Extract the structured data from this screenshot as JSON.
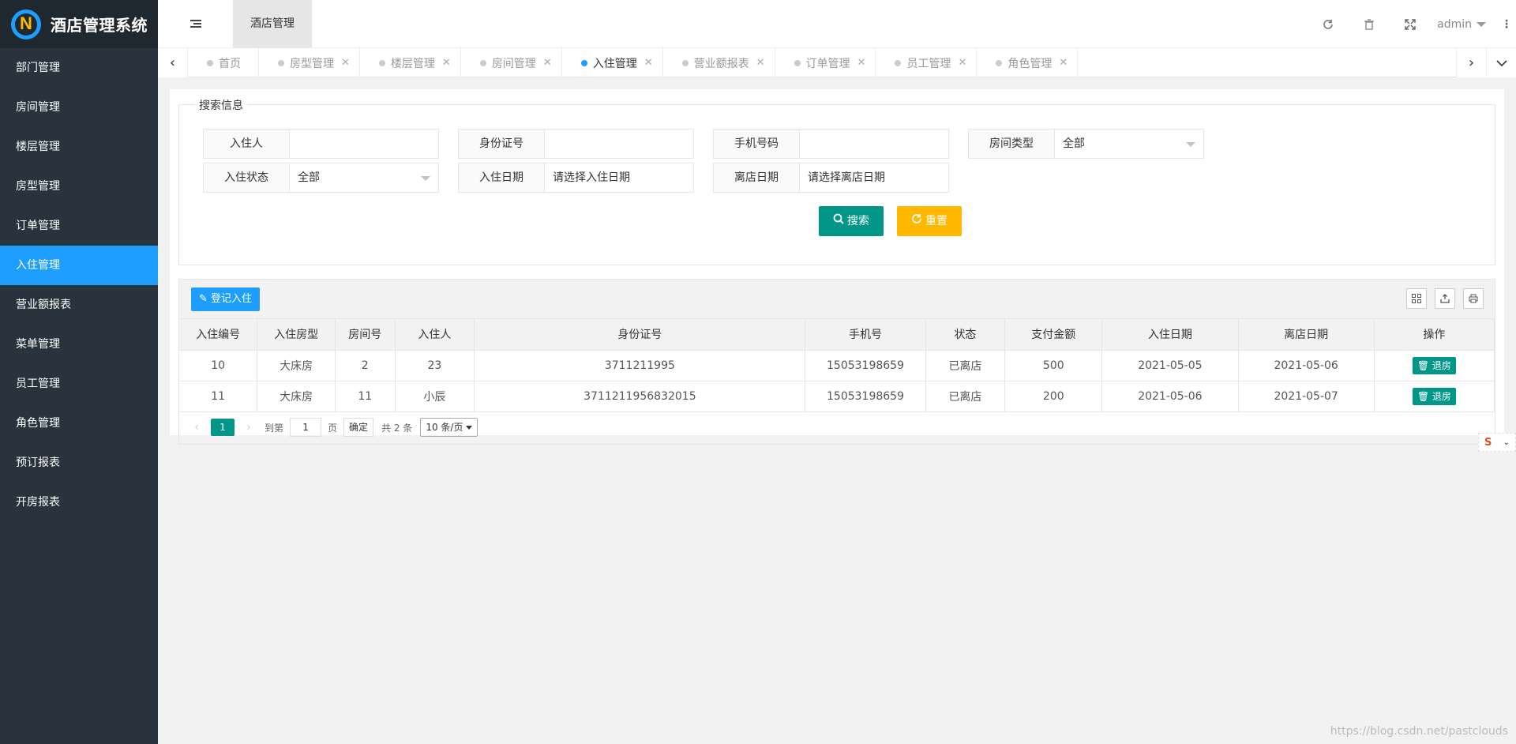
{
  "app": {
    "title": "酒店管理系统"
  },
  "sidebar": {
    "items": [
      {
        "label": "部门管理"
      },
      {
        "label": "房间管理"
      },
      {
        "label": "楼层管理"
      },
      {
        "label": "房型管理"
      },
      {
        "label": "订单管理"
      },
      {
        "label": "入住管理",
        "active": true
      },
      {
        "label": "营业额报表"
      },
      {
        "label": "菜单管理"
      },
      {
        "label": "员工管理"
      },
      {
        "label": "角色管理"
      },
      {
        "label": "预订报表"
      },
      {
        "label": "开房报表"
      }
    ]
  },
  "header": {
    "tab": "酒店管理",
    "user": "admin",
    "icons": [
      "menu-icon",
      "refresh-icon",
      "trash-icon",
      "fullscreen-icon",
      "more-icon"
    ]
  },
  "tabs": [
    {
      "label": "首页",
      "closable": false
    },
    {
      "label": "房型管理",
      "closable": true
    },
    {
      "label": "楼层管理",
      "closable": true
    },
    {
      "label": "房间管理",
      "closable": true
    },
    {
      "label": "入住管理",
      "closable": true,
      "active": true
    },
    {
      "label": "营业额报表",
      "closable": true
    },
    {
      "label": "订单管理",
      "closable": true
    },
    {
      "label": "员工管理",
      "closable": true
    },
    {
      "label": "角色管理",
      "closable": true
    }
  ],
  "search": {
    "legend": "搜索信息",
    "fields": {
      "guest": {
        "label": "入住人",
        "value": ""
      },
      "id_card": {
        "label": "身份证号",
        "value": ""
      },
      "phone": {
        "label": "手机号码",
        "value": ""
      },
      "room_type": {
        "label": "房间类型",
        "value": "全部"
      },
      "status": {
        "label": "入住状态",
        "value": "全部"
      },
      "checkin_date": {
        "label": "入住日期",
        "placeholder": "请选择入住日期"
      },
      "checkout_date": {
        "label": "离店日期",
        "placeholder": "请选择离店日期"
      }
    },
    "search_button": "搜索",
    "reset_button": "重置"
  },
  "table": {
    "register_button": "登记入住",
    "columns": [
      "入住编号",
      "入住房型",
      "房间号",
      "入住人",
      "身份证号",
      "手机号",
      "状态",
      "支付金额",
      "入住日期",
      "离店日期",
      "操作"
    ],
    "rows": [
      {
        "id": "10",
        "room_type": "大床房",
        "room_no": "2",
        "guest": "23",
        "id_card": "3711211995",
        "phone": "15053198659",
        "status": "已离店",
        "amount": "500",
        "checkin": "2021-05-05",
        "checkout": "2021-05-06",
        "action": "退房"
      },
      {
        "id": "11",
        "room_type": "大床房",
        "room_no": "11",
        "guest": "小辰",
        "id_card": "3711211956832015",
        "phone": "15053198659",
        "status": "已离店",
        "amount": "200",
        "checkin": "2021-05-06",
        "checkout": "2021-05-07",
        "action": "退房"
      }
    ]
  },
  "pager": {
    "current": "1",
    "goto_label": "到第",
    "goto_value": "1",
    "page_unit": "页",
    "confirm": "确定",
    "total": "共 2 条",
    "page_size": "10 条/页"
  },
  "watermark": "https://blog.csdn.net/pastclouds",
  "colors": {
    "sidebar_bg": "#28333e",
    "accent_blue": "#1e9fff",
    "green": "#009688",
    "yellow": "#ffb800"
  }
}
